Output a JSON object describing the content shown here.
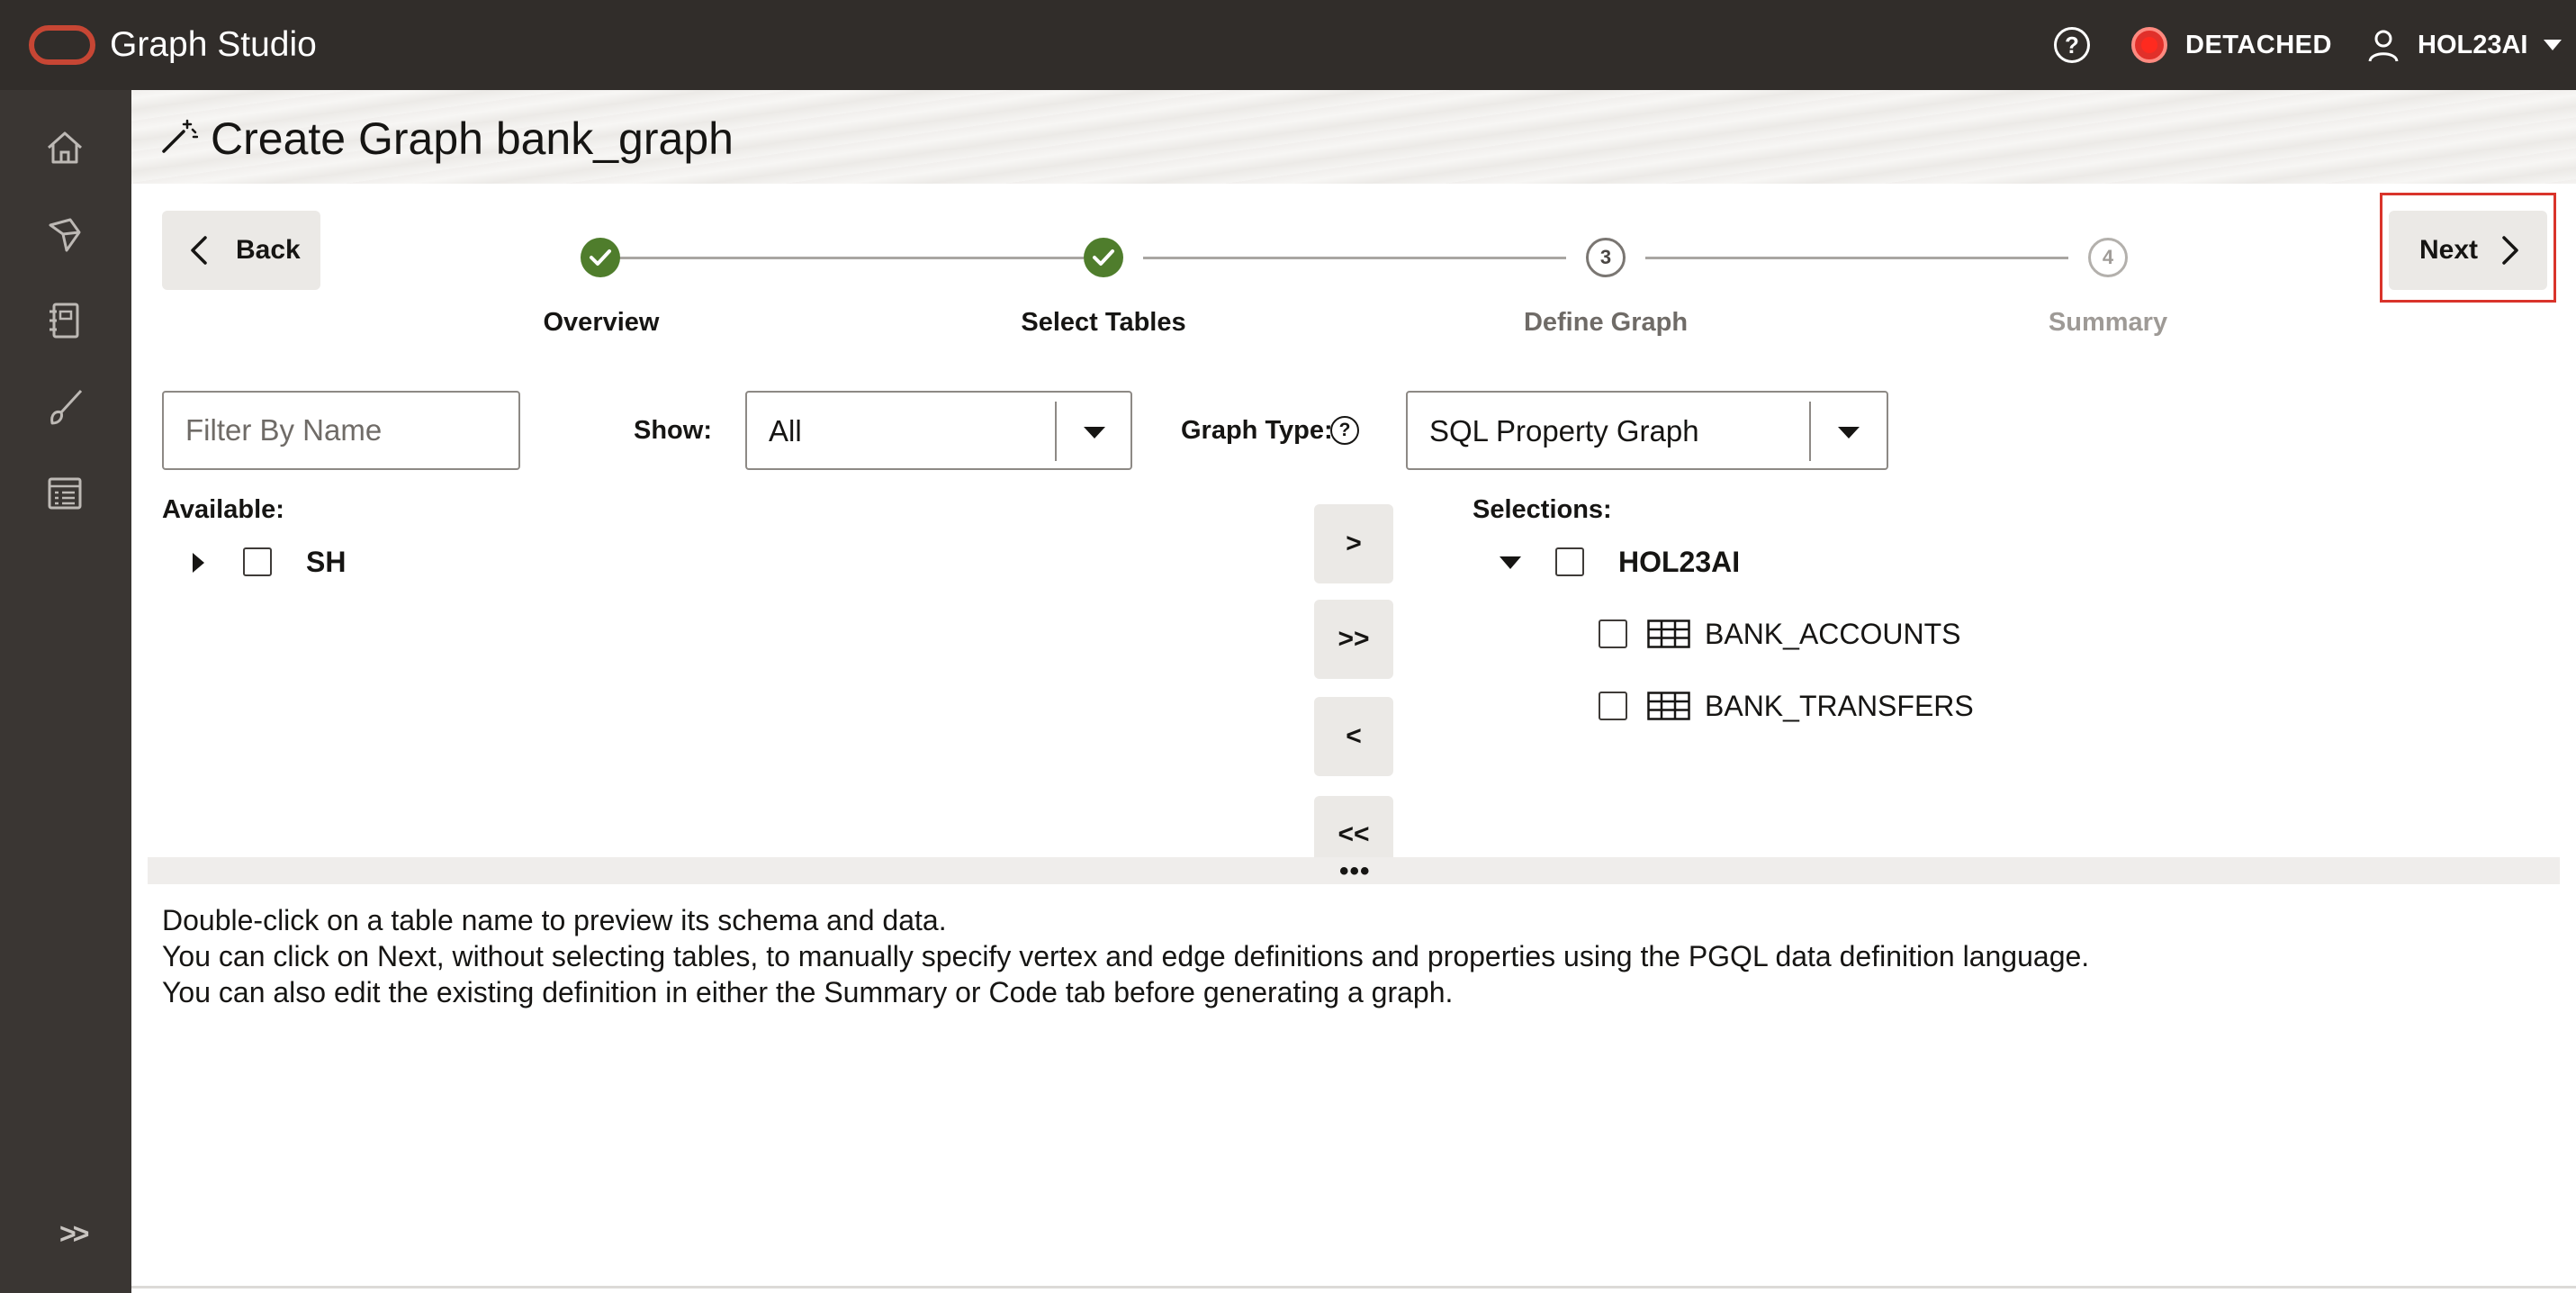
{
  "app": {
    "title": "Graph Studio"
  },
  "topbar": {
    "help_icon": "help-circle-icon",
    "status": "DETACHED",
    "status_color": "#e1302a",
    "user": "HOL23AI"
  },
  "sidebar": {
    "items": [
      {
        "icon": "home-icon"
      },
      {
        "icon": "graph-model-icon"
      },
      {
        "icon": "notebook-icon"
      },
      {
        "icon": "brush-icon"
      },
      {
        "icon": "jobs-icon"
      }
    ],
    "expand_label": ">>"
  },
  "page": {
    "title": "Create Graph bank_graph"
  },
  "nav": {
    "back_label": "Back",
    "next_label": "Next"
  },
  "stepper": {
    "steps": [
      {
        "label": "Overview",
        "state": "complete"
      },
      {
        "label": "Select Tables",
        "state": "complete"
      },
      {
        "label": "Define Graph",
        "number": "3",
        "state": "pending"
      },
      {
        "label": "Summary",
        "number": "4",
        "state": "pending"
      }
    ]
  },
  "filters": {
    "filter_placeholder": "Filter By Name",
    "show_label": "Show:",
    "show_value": "All",
    "graph_type_label": "Graph Type:",
    "graph_type_value": "SQL Property Graph"
  },
  "available": {
    "label": "Available:",
    "items": [
      {
        "name": "SH"
      }
    ]
  },
  "move_buttons": {
    "add": ">",
    "add_all": ">>",
    "remove": "<",
    "remove_all": "<<"
  },
  "selections": {
    "label": "Selections:",
    "schema": "HOL23AI",
    "tables": [
      "BANK_ACCOUNTS",
      "BANK_TRANSFERS"
    ]
  },
  "splitter": {
    "handle": "•••"
  },
  "info": {
    "lines": [
      "Double-click on a table name to preview its schema and data.",
      "You can click on Next, without selecting tables, to manually specify vertex and edge definitions and properties using the PGQL data definition language.",
      "You can also edit the existing definition in either the Summary or Code tab before generating a graph."
    ]
  },
  "colors": {
    "accent_green": "#4f7d2c",
    "highlight_red": "#d9342b",
    "topbar": "#312d2a"
  }
}
